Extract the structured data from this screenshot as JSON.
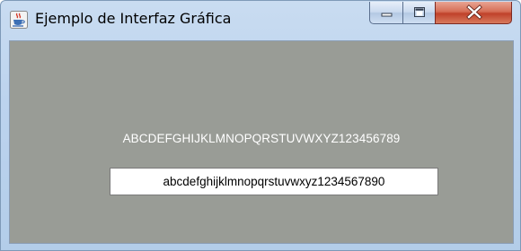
{
  "window": {
    "title": "Ejemplo de Interfaz Gráfica",
    "app_icon": "java-coffee-cup-icon",
    "controls": {
      "minimize_icon": "minimize-icon",
      "maximize_icon": "maximize-icon",
      "close_icon": "close-icon"
    }
  },
  "content": {
    "label_text": "ABCDEFGHIJKLMNOPQRSTUVWXYZ123456789",
    "text_field_value": "abcdefghijklmnopqrstuvwxyz1234567890"
  },
  "colors": {
    "panel_background": "#999c96",
    "label_color": "#ffffff",
    "close_button": "#c9462c",
    "title_bar": "#bcd3ee"
  }
}
